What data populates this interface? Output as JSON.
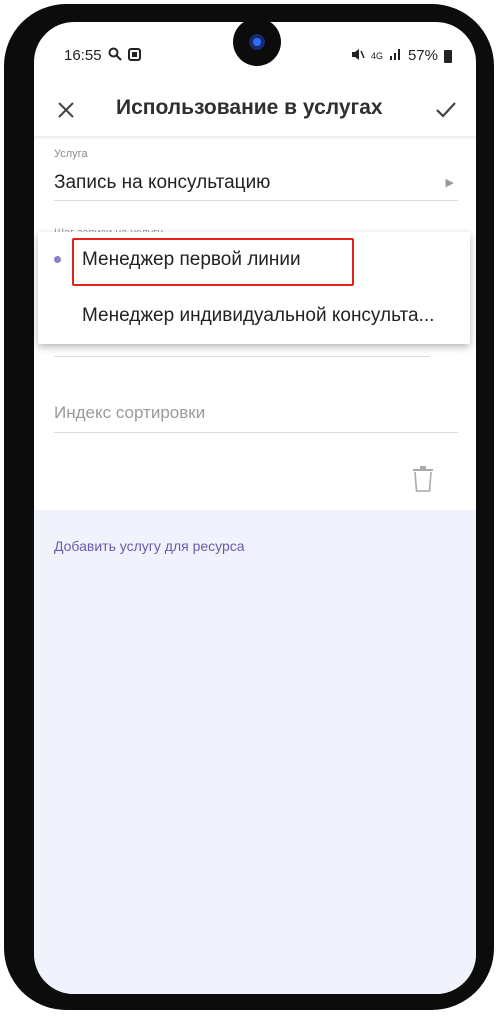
{
  "status_bar": {
    "time": "16:55",
    "left_icons": [
      "search-icon",
      "gallery-icon"
    ],
    "signal": "4G",
    "battery": "57%"
  },
  "app_bar": {
    "title": "Использование в услугах",
    "close_icon": "close-icon",
    "confirm_icon": "check-icon"
  },
  "form": {
    "service": {
      "caption": "Услуга",
      "value": "Запись на консультацию"
    },
    "step_caption_partial": "Шаг записи на услугу",
    "sort_index_placeholder": "Индекс сортировки"
  },
  "dropdown": {
    "items": [
      {
        "label": "Менеджер первой линии",
        "selected": true
      },
      {
        "label": "Менеджер индивидуальной консульта..."
      }
    ]
  },
  "add_service_link": "Добавить услугу для ресурса",
  "colors": {
    "accent": "#6a5aa8",
    "highlight_box": "#e2231a",
    "lower_background": "#f0f3fb"
  }
}
